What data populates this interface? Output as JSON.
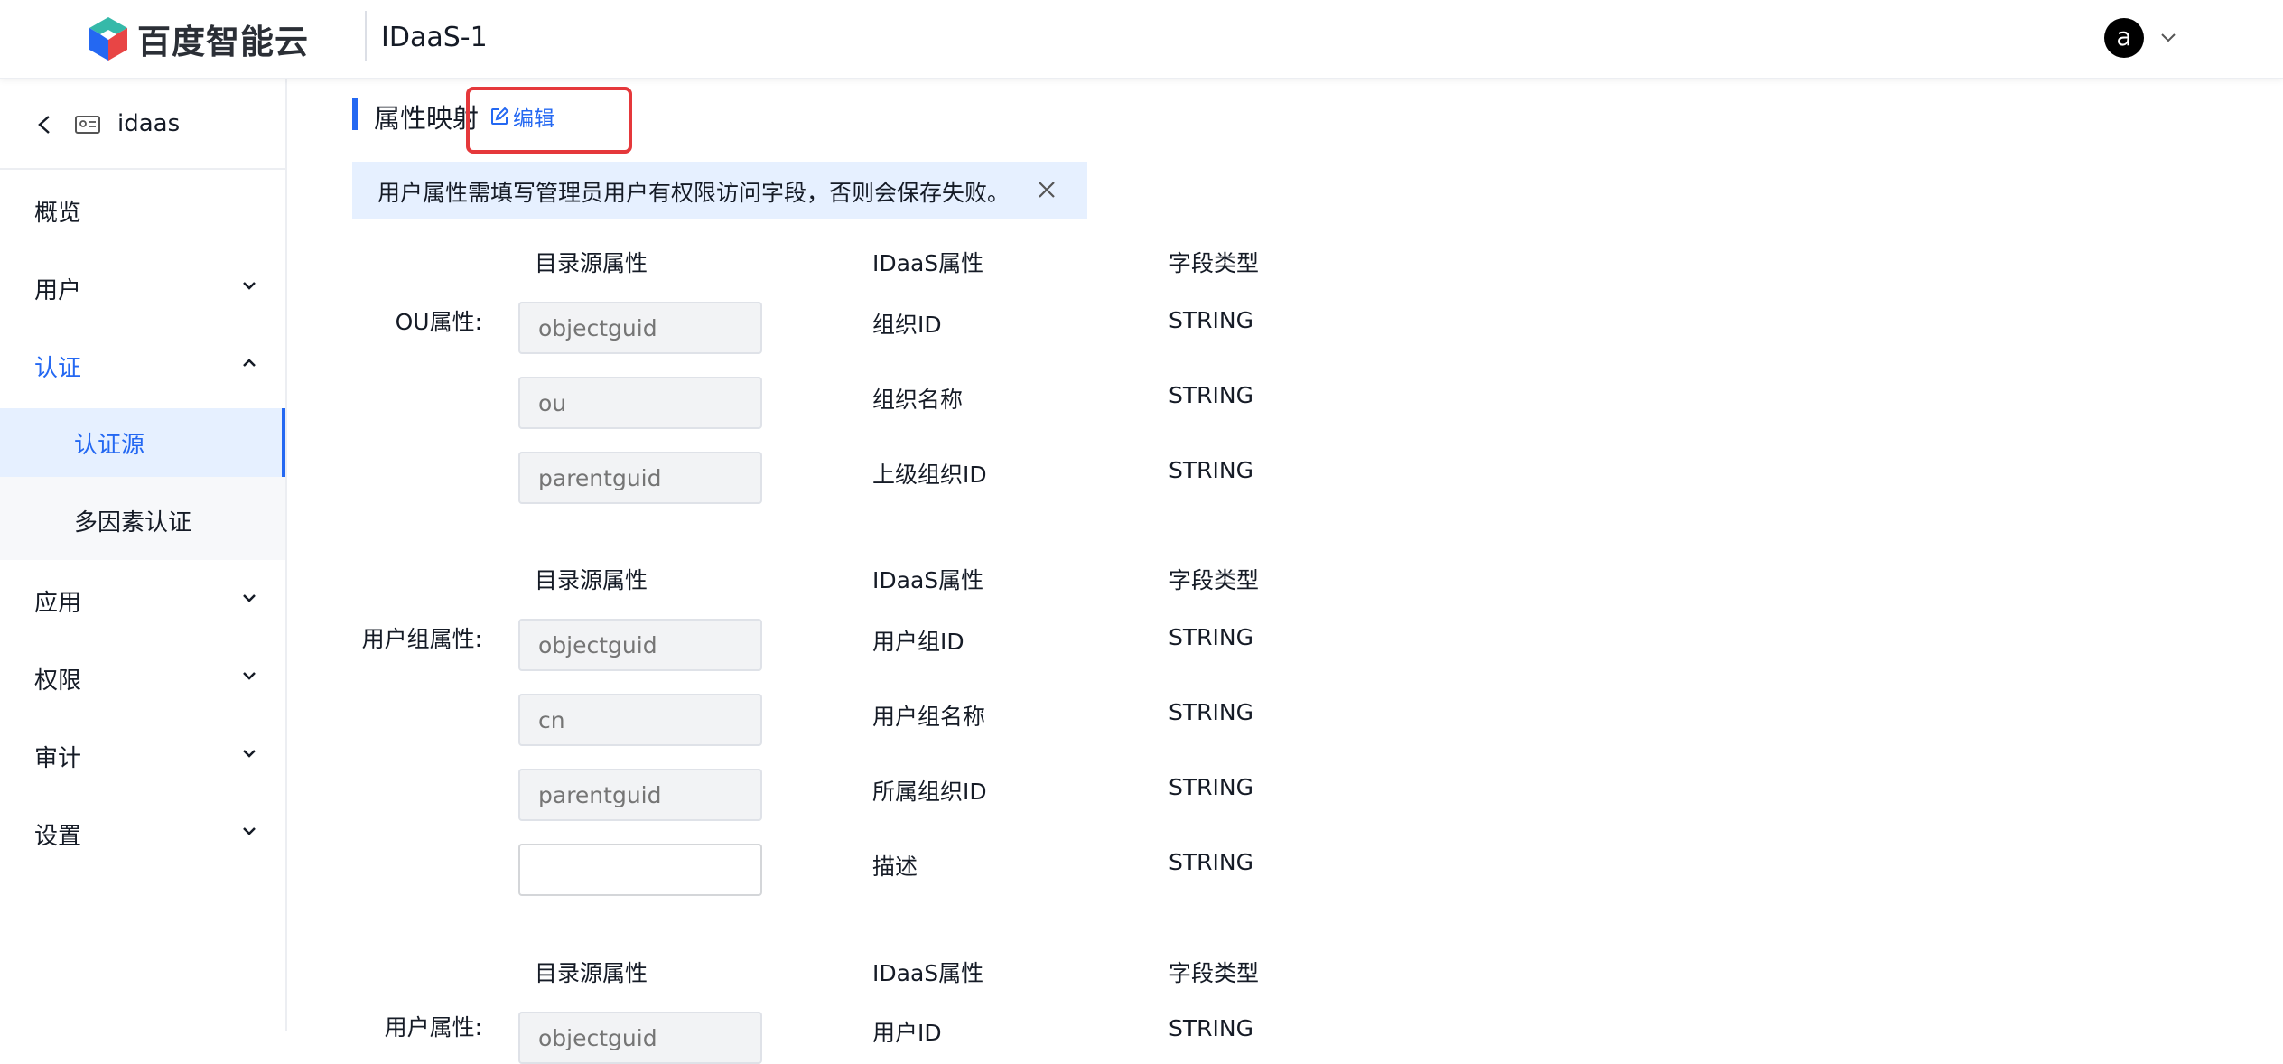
{
  "topbar": {
    "brand": "百度智能云",
    "product": "IDaaS-1",
    "avatar_letter": "a"
  },
  "sidebar": {
    "title": "idaas",
    "items": [
      {
        "label": "概览"
      },
      {
        "label": "用户"
      },
      {
        "label": "认证"
      },
      {
        "label": "应用"
      },
      {
        "label": "权限"
      },
      {
        "label": "审计"
      },
      {
        "label": "设置"
      }
    ],
    "sub_items": [
      {
        "label": "认证源"
      },
      {
        "label": "多因素认证"
      }
    ]
  },
  "main": {
    "section_title": "属性映射",
    "edit_label": "编辑",
    "notice": "用户属性需填写管理员用户有权限访问字段，否则会保存失败。",
    "headers": {
      "source": "目录源属性",
      "idaas": "IDaaS属性",
      "type": "字段类型"
    },
    "groups": [
      {
        "label": "OU属性:",
        "rows": [
          {
            "source": "objectguid",
            "idaas": "组织ID",
            "type": "STRING"
          },
          {
            "source": "ou",
            "idaas": "组织名称",
            "type": "STRING"
          },
          {
            "source": "parentguid",
            "idaas": "上级组织ID",
            "type": "STRING"
          }
        ]
      },
      {
        "label": "用户组属性:",
        "rows": [
          {
            "source": "objectguid",
            "idaas": "用户组ID",
            "type": "STRING"
          },
          {
            "source": "cn",
            "idaas": "用户组名称",
            "type": "STRING"
          },
          {
            "source": "parentguid",
            "idaas": "所属组织ID",
            "type": "STRING"
          },
          {
            "source": "",
            "idaas": "描述",
            "type": "STRING"
          }
        ]
      },
      {
        "label": "用户属性:",
        "rows": [
          {
            "source": "objectguid",
            "idaas": "用户ID",
            "type": "STRING"
          }
        ]
      }
    ]
  },
  "colors": {
    "accent": "#2468f2",
    "highlight": "#e5383b",
    "notice_bg": "#e6f0ff"
  }
}
